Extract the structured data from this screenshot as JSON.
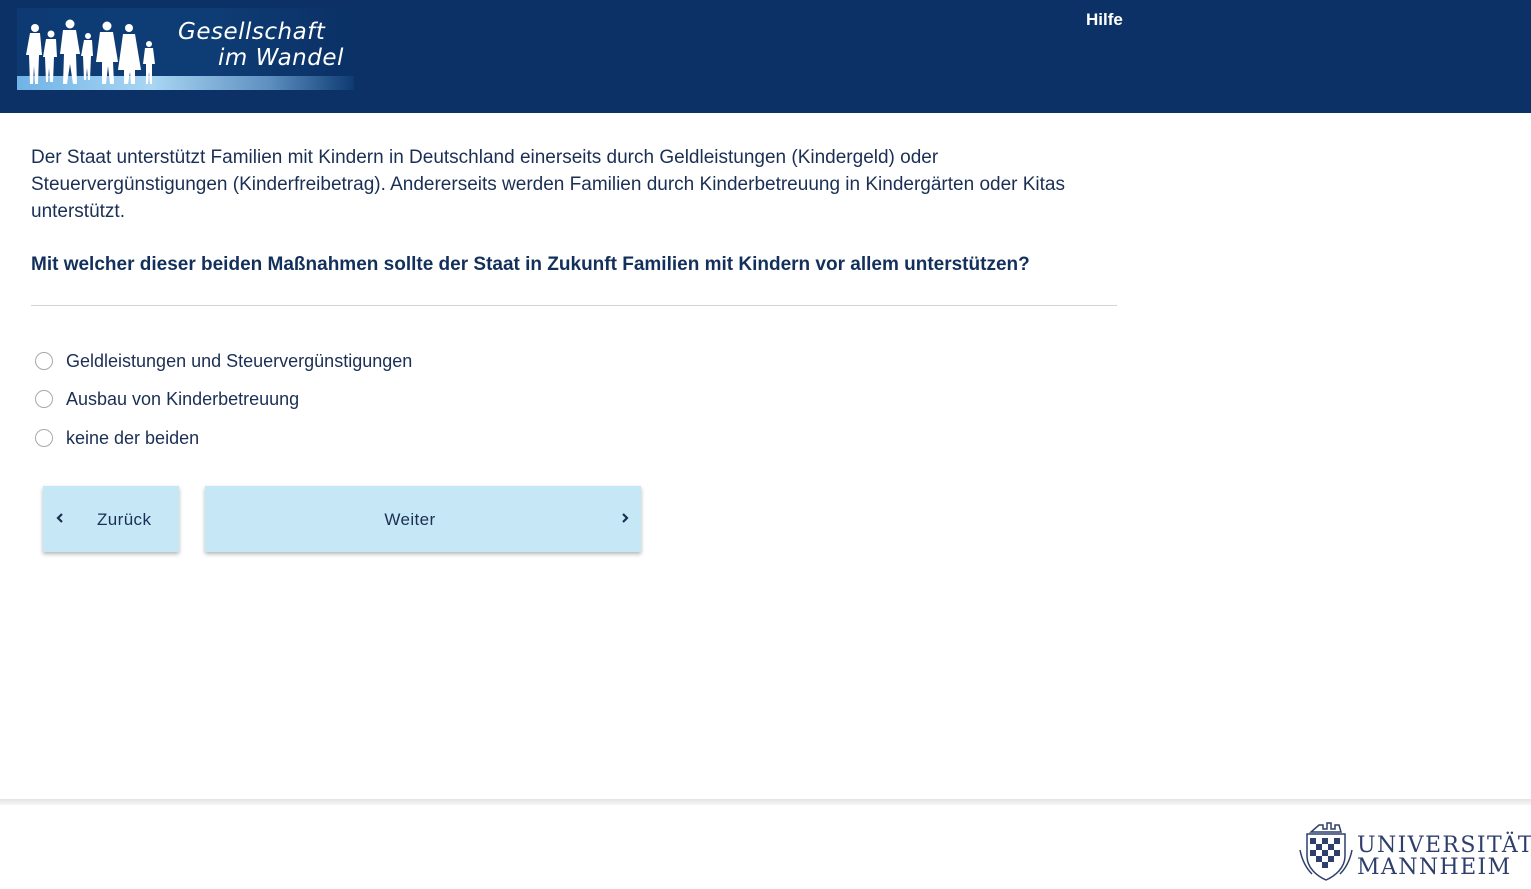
{
  "header": {
    "logo": {
      "line1": "Gesellschaft",
      "line2": "im Wandel"
    },
    "help_label": "Hilfe"
  },
  "survey": {
    "intro": "Der Staat unterstützt Familien mit Kindern in Deutschland einerseits durch Geldleistungen (Kindergeld) oder Steuervergünstigungen (Kinderfreibetrag). Andererseits werden Familien durch Kinderbetreuung in Kindergärten oder Kitas unterstützt.",
    "question": "Mit welcher dieser beiden Maßnahmen sollte der Staat in Zukunft Familien mit Kindern vor allem unterstützen?",
    "options": [
      {
        "label": "Geldleistungen und Steuervergünstigungen",
        "selected": false
      },
      {
        "label": "Ausbau von Kinderbetreuung",
        "selected": false
      },
      {
        "label": "keine der beiden",
        "selected": false
      }
    ]
  },
  "navigation": {
    "back_label": "Zurück",
    "next_label": "Weiter",
    "back_icon": "chevron-left-icon",
    "next_icon": "chevron-right-icon"
  },
  "footer": {
    "university_line1": "UNIVERSITÄT",
    "university_line2": "MANNHEIM"
  },
  "colors": {
    "header_bg": "#0b3166",
    "text": "#1b2f55",
    "button_bg": "#c6e7f5",
    "divider": "#d4d4d4"
  }
}
